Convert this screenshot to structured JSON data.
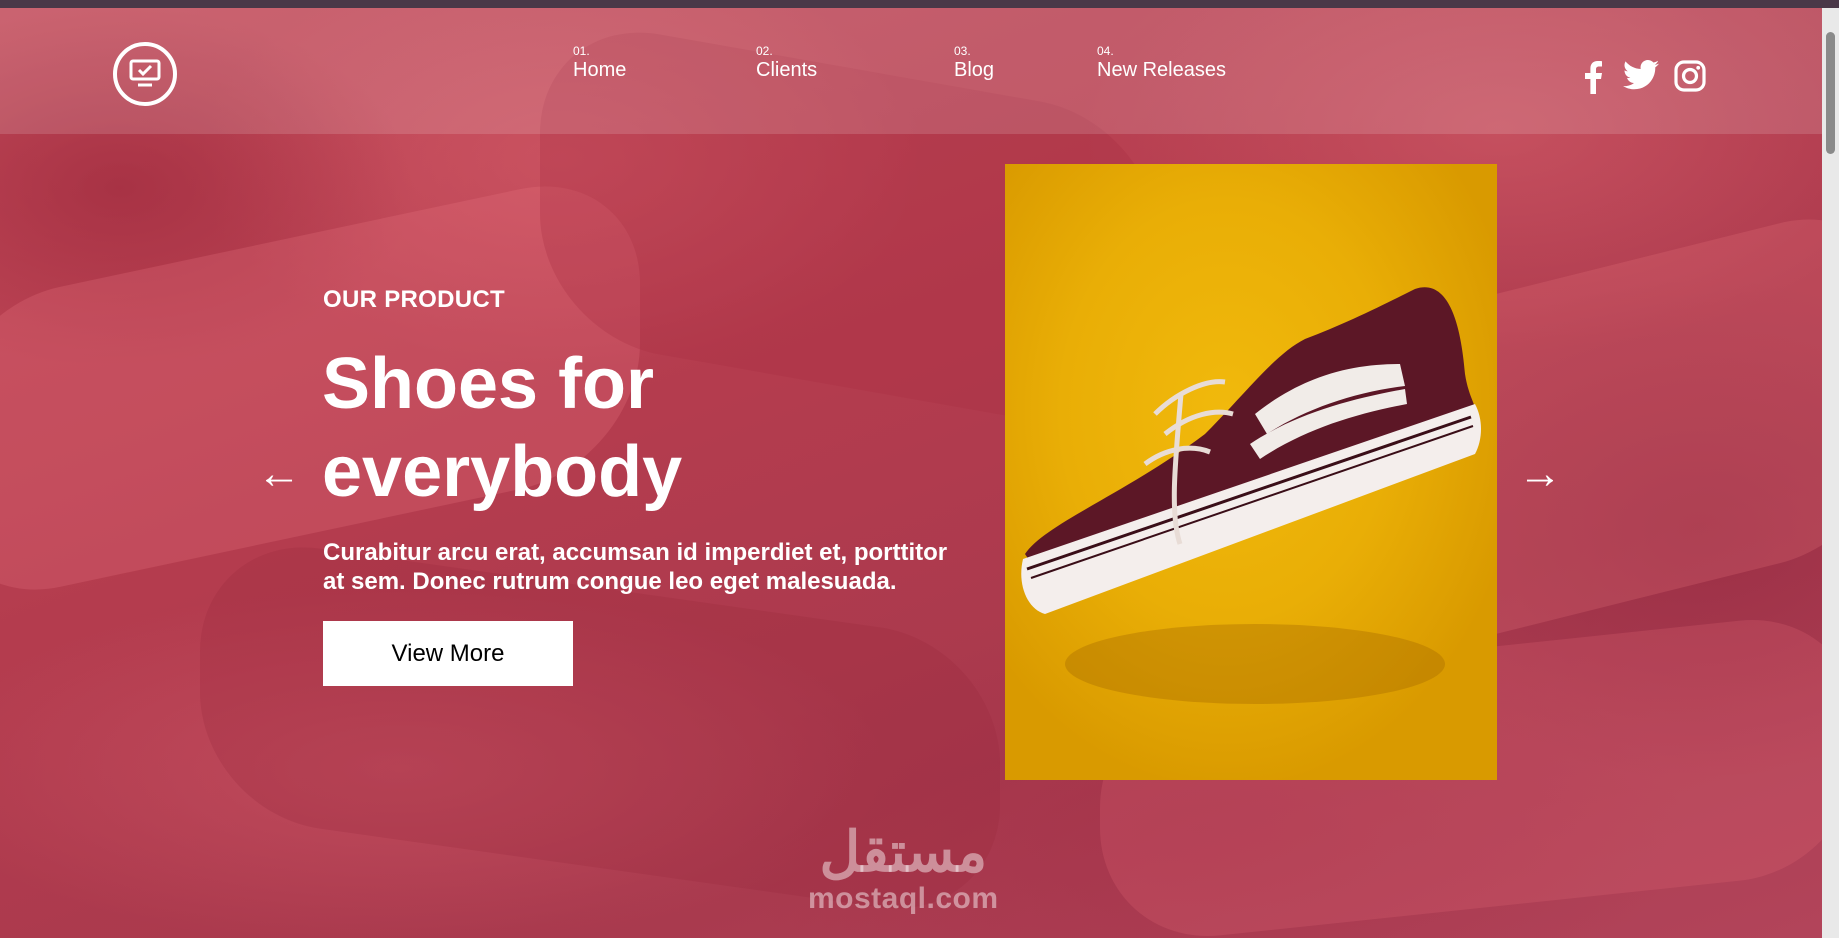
{
  "nav": {
    "items": [
      {
        "num": "01.",
        "label": "Home"
      },
      {
        "num": "02.",
        "label": "Clients"
      },
      {
        "num": "03.",
        "label": "Blog"
      },
      {
        "num": "04.",
        "label": "New Releases"
      }
    ]
  },
  "social": {
    "icons": [
      "facebook-icon",
      "twitter-icon",
      "instagram-icon"
    ]
  },
  "hero": {
    "eyebrow": "OUR PRODUCT",
    "title_line1": "Shoes for",
    "title_line2": "everybody",
    "text_line1": "Curabitur arcu erat, accumsan id imperdiet et, porttitor",
    "text_line2": "at sem. Donec rutrum congue leo eget malesuada.",
    "button_label": "View More",
    "prev_arrow": "←",
    "next_arrow": "→"
  },
  "watermark": {
    "arabic": "مستقل",
    "latin": "mostaql.com"
  },
  "colors": {
    "background": "#b8434f",
    "product_bg": "#ebb007",
    "shoe_upper": "#5c1726",
    "text": "#ffffff"
  }
}
